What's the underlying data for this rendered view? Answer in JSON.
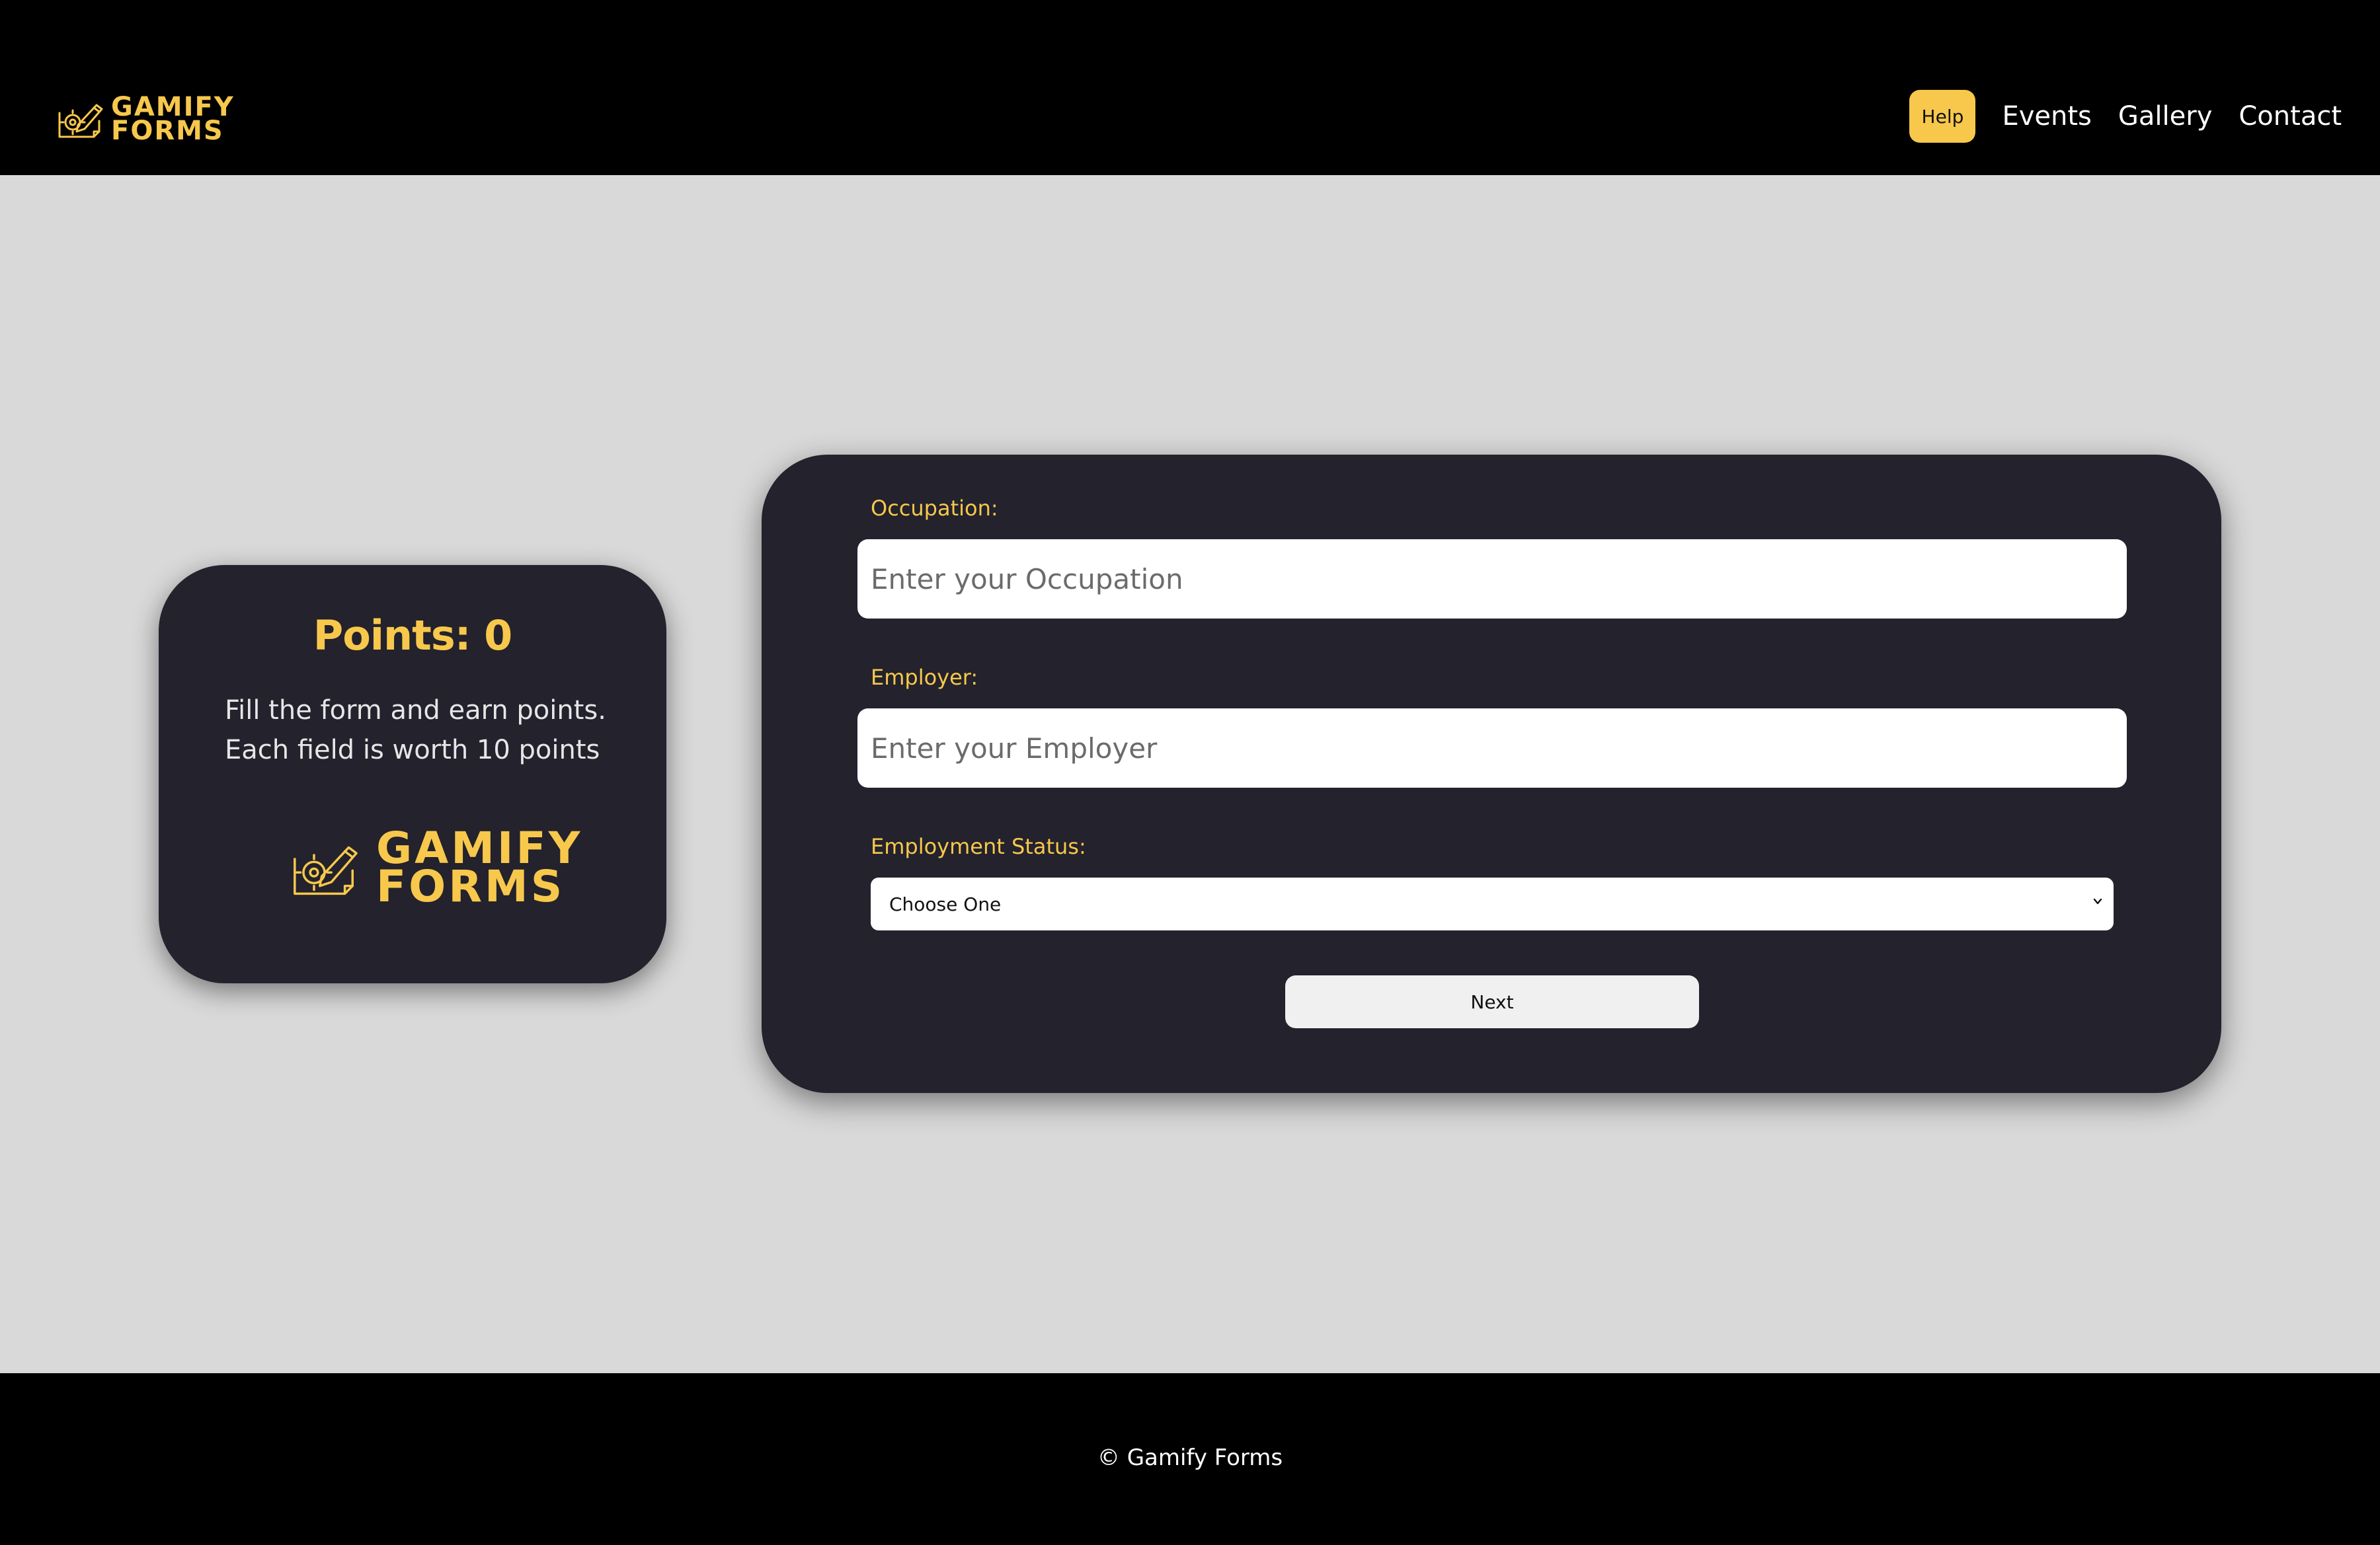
{
  "brand": {
    "line1": "GAMIFY",
    "line2": "FORMS",
    "icon": "pencil-gear-logo-icon",
    "color": "#f7c84c"
  },
  "nav": {
    "help_label": "Help",
    "links": [
      "Events",
      "Gallery",
      "Contact"
    ]
  },
  "points_card": {
    "title": "Points: 0",
    "desc_line1": "Fill the form and earn points.",
    "desc_line2": "Each field is worth 10 points",
    "logo_line1": "GAMIFY",
    "logo_line2": "FORMS"
  },
  "form": {
    "occupation_label": "Occupation:",
    "occupation_placeholder": "Enter your Occupation",
    "occupation_value": "",
    "employer_label": "Employer:",
    "employer_placeholder": "Enter your Employer",
    "employer_value": "",
    "status_label": "Employment Status:",
    "status_selected": "Choose One",
    "next_label": "Next"
  },
  "footer": {
    "text": "© Gamify Forms"
  },
  "colors": {
    "accent": "#f7c84c",
    "card_bg": "#23222d",
    "page_bg": "#d9d9d9",
    "bar_bg": "#000000"
  }
}
